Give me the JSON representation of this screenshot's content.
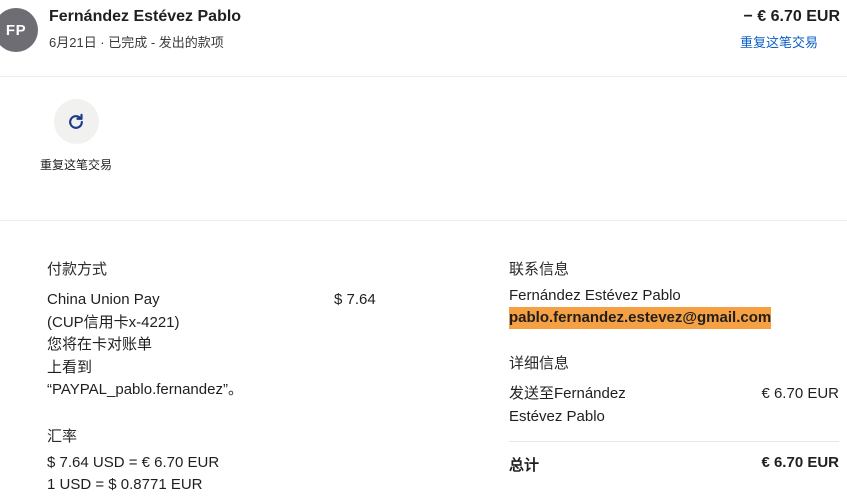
{
  "header": {
    "avatar_initials": "FP",
    "name": "Fernández Estévez Pablo",
    "subline": "6月21日 · 已完成 - 发出的款项",
    "amount": "− € 6.70 EUR",
    "repeat_link": "重复这笔交易"
  },
  "actions": {
    "repeat_label": "重复这笔交易",
    "repeat_icon": "refresh-icon"
  },
  "payment": {
    "section_label": "付款方式",
    "method_lines": [
      "China Union Pay",
      "(CUP信用卡x-4221)",
      "您将在卡对账单",
      "上看到",
      "“PAYPAL_pablo.fernandez”。"
    ],
    "amount": "$ 7.64"
  },
  "exchange": {
    "section_label": "汇率",
    "line1": "$ 7.64 USD = € 6.70 EUR",
    "line2": "1 USD = $ 0.8771 EUR"
  },
  "contact": {
    "section_label": "联系信息",
    "name": "Fernández Estévez Pablo",
    "email": "pablo.fernandez.estevez@gmail.com",
    "email_highlight_color": "#f5a042"
  },
  "details": {
    "section_label": "详细信息",
    "sent_to_lines": [
      "发送至Fernández",
      "Estévez Pablo"
    ],
    "amount": "€ 6.70 EUR",
    "total_label": "总计",
    "total_amount": "€ 6.70 EUR"
  },
  "colors": {
    "link": "#0a5fc4",
    "avatar_bg": "#6d6d73",
    "icon": "#1b3a8c"
  }
}
